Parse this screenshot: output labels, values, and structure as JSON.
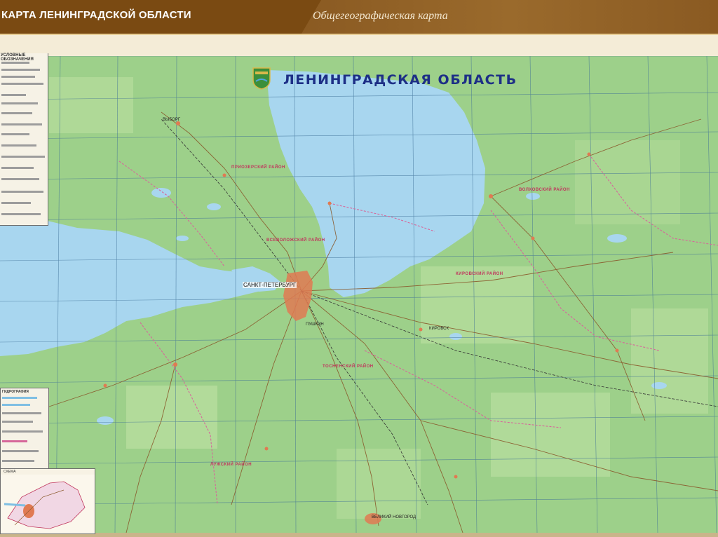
{
  "header": {
    "title": "КАРТА ЛЕНИНГРАДСКОЙ ОБЛАСТИ",
    "subtitle": "Общегеографическая карта"
  },
  "map": {
    "title": "ЛЕНИНГРАДСКАЯ ОБЛАСТЬ",
    "main_city_label": "САНКТ-ПЕТЕРБУРГ",
    "city_labels": [
      "ПУШКИН",
      "ВЕЛИКИЙ НОВГОРОД",
      "ВЫБОРГ",
      "КИРОВСК"
    ],
    "district_labels": [
      "ПРИОЗЕРСКИЙ РАЙОН",
      "ВСЕВОЛОЖСКИЙ РАЙОН",
      "КИРОВСКИЙ РАЙОН",
      "ТОСНЕНСКИЙ РАЙОН",
      "ВОЛХОВСКИЙ РАЙОН",
      "ЛУЖСКИЙ РАЙОН"
    ],
    "legend_title": "УСЛОВНЫЕ ОБОЗНАЧЕНИЯ",
    "legend2_title": "ГИДРОГРАФИЯ",
    "inset_title": "СХЕМА",
    "colors": {
      "land": "#9dd08a",
      "water": "#a8d6ef",
      "road": "#8a5a2c",
      "border": "#d6679a",
      "grid": "#3d6f96",
      "city": "#e07a52"
    }
  }
}
